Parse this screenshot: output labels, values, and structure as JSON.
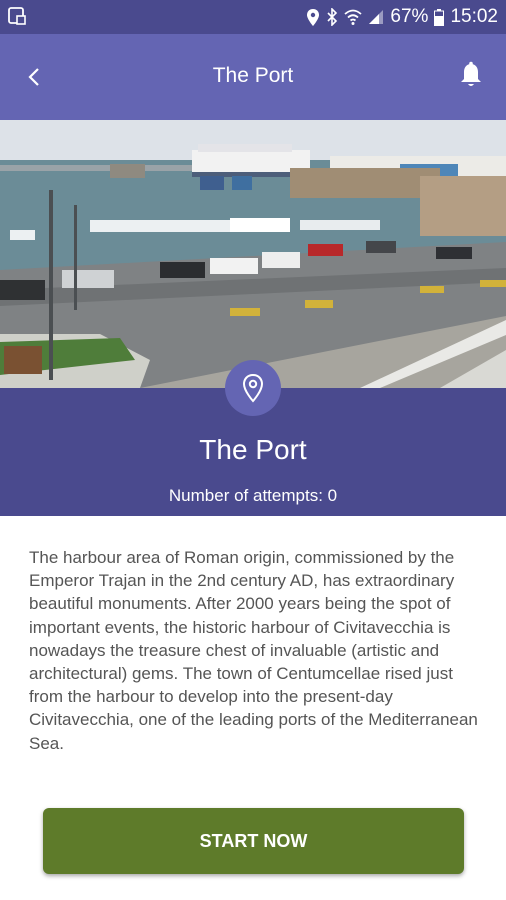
{
  "status_bar": {
    "battery": "67%",
    "time": "15:02",
    "icons": [
      "screenshot-icon",
      "location-icon",
      "bluetooth-icon",
      "wifi-icon",
      "signal-icon",
      "battery-icon"
    ]
  },
  "app_bar": {
    "title": "The Port",
    "back_icon": "back-arrow-icon",
    "bell_icon": "notification-bell-icon"
  },
  "hero": {
    "icon": "map-pin-icon",
    "place_name": "The Port",
    "attempts_label": "Number of attempts: 0"
  },
  "description": "The harbour area of Roman origin, commissioned by the Emperor Trajan in the 2nd century AD, has extraordinary beautiful monuments. After 2000 years being the spot of important events, the historic harbour of Civitavecchia is nowadays the treasure chest of invaluable (artistic and architectural) gems. The town of Centumcellae rised just from the harbour to develop into the present-day Civitavecchia, one of the leading ports of the Mediterranean Sea.",
  "actions": {
    "start_label": "START NOW"
  },
  "colors": {
    "status_bar": "#4a4a8e",
    "app_bar": "#6465b3",
    "hero_band": "#4a4a8e",
    "button": "#5e7b2a"
  }
}
